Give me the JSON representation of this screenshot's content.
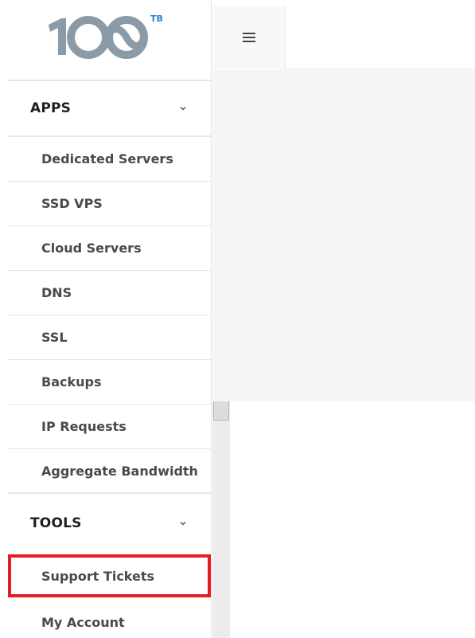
{
  "logo": {
    "number": "100",
    "superscript": "TB"
  },
  "header": {
    "menu_icon": "hamburger-icon"
  },
  "sidebar": {
    "sections": [
      {
        "title": "APPS",
        "icon": "chevron-down-icon",
        "items": [
          {
            "label": "Dedicated Servers"
          },
          {
            "label": "SSD VPS"
          },
          {
            "label": "Cloud Servers"
          },
          {
            "label": "DNS"
          },
          {
            "label": "SSL"
          },
          {
            "label": "Backups"
          },
          {
            "label": "IP Requests"
          },
          {
            "label": "Aggregate Bandwidth"
          }
        ]
      },
      {
        "title": "TOOLS",
        "icon": "chevron-down-icon",
        "items": [
          {
            "label": "Support Tickets",
            "highlighted": true
          },
          {
            "label": "My Account"
          }
        ]
      }
    ]
  },
  "colors": {
    "highlight": "#e51c24",
    "logo_grey": "#8a9aa6",
    "logo_accent": "#2c7fd6"
  }
}
